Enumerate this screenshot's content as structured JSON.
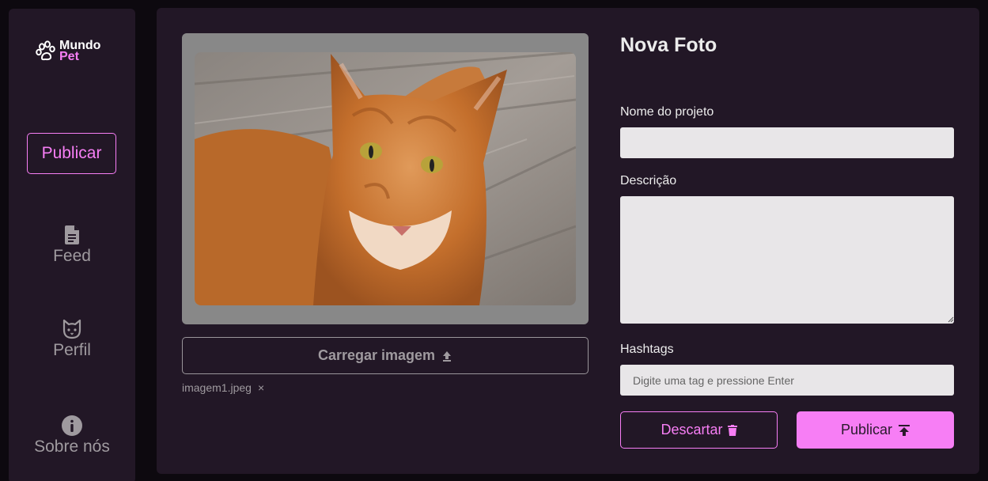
{
  "sidebar": {
    "logo": {
      "line1": "Mundo",
      "line2": "Pet"
    },
    "publish_label": "Publicar",
    "nav": [
      {
        "label": "Feed",
        "icon": "document-icon"
      },
      {
        "label": "Perfil",
        "icon": "cat-face-icon"
      },
      {
        "label": "Sobre nós",
        "icon": "info-icon"
      }
    ]
  },
  "main": {
    "title": "Nova Foto",
    "upload_label": "Carregar imagem",
    "file_name": "imagem1.jpeg",
    "file_remove": "×",
    "fields": {
      "project_label": "Nome do projeto",
      "project_value": "",
      "description_label": "Descrição",
      "description_value": "",
      "hashtags_label": "Hashtags",
      "hashtags_placeholder": "Digite uma tag e pressione Enter"
    },
    "discard_label": "Descartar",
    "publish_label": "Publicar"
  },
  "colors": {
    "accent": "#f77ef5",
    "panel": "#221726",
    "background": "#0d090f",
    "field": "#e8e6e8",
    "frame": "#888888"
  }
}
